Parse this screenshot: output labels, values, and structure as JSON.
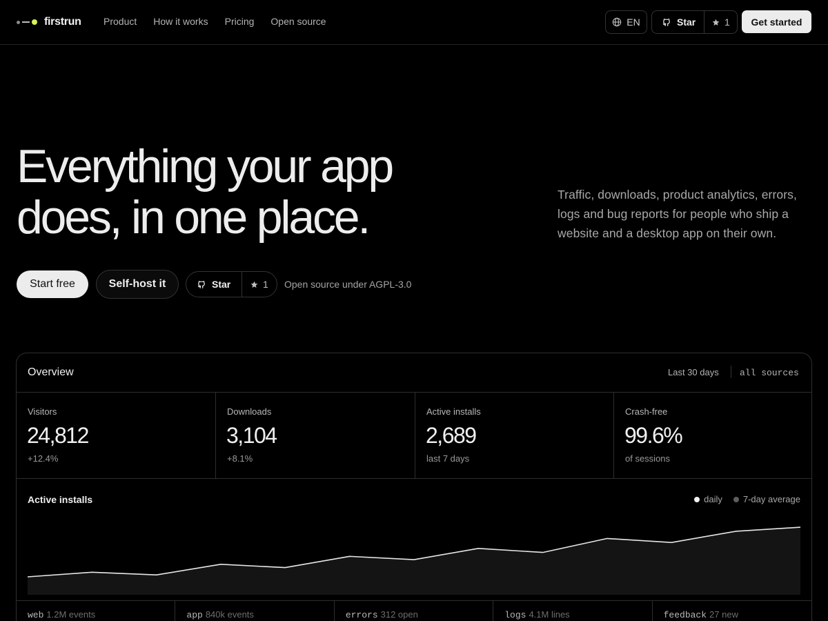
{
  "brand": {
    "name": "firstrun",
    "accent": "#d5f25a"
  },
  "nav": {
    "links": [
      "Product",
      "How it works",
      "Pricing",
      "Open source"
    ],
    "language": "EN",
    "star_label": "Star",
    "star_count": "1",
    "cta": "Get started"
  },
  "hero": {
    "title_line1": "Everything your app",
    "title_line2": "does, in one place.",
    "subtitle": "Traffic, downloads, product analytics, errors, logs and bug reports for people who ship a website and a desktop app on their own.",
    "primary_cta": "Start free",
    "secondary_cta": "Self-host it",
    "star_label": "Star",
    "star_count": "1",
    "license_note": "Open source under AGPL-3.0"
  },
  "overview": {
    "title": "Overview",
    "range": "Last 30 days",
    "sources_filter": "all sources",
    "stats": [
      {
        "label": "Visitors",
        "value": "24,812",
        "delta": "+12.4%"
      },
      {
        "label": "Downloads",
        "value": "3,104",
        "delta": "+8.1%"
      },
      {
        "label": "Active installs",
        "value": "2,689",
        "delta": "last 7 days"
      },
      {
        "label": "Crash-free",
        "value": "99.6%",
        "delta": "of sessions"
      }
    ],
    "chart_title": "Active installs",
    "legend": [
      {
        "label": "daily",
        "color": "#f2f2f2"
      },
      {
        "label": "7-day average",
        "color": "#5e5e5e"
      }
    ],
    "sources": [
      {
        "name": "web",
        "count": "1.2M events"
      },
      {
        "name": "app",
        "count": "840k events"
      },
      {
        "name": "errors",
        "count": "312 open"
      },
      {
        "name": "logs",
        "count": "4.1M lines"
      },
      {
        "name": "feedback",
        "count": "27 new"
      }
    ]
  },
  "chart_data": {
    "type": "area",
    "title": "Active installs",
    "series": [
      {
        "name": "daily",
        "values": [
          0.25,
          0.32,
          0.28,
          0.44,
          0.39,
          0.56,
          0.51,
          0.68,
          0.62,
          0.83,
          0.77,
          0.94,
          1.0
        ]
      }
    ],
    "ylim": [
      0,
      1
    ],
    "grid": false,
    "legend_position": "top-right"
  }
}
